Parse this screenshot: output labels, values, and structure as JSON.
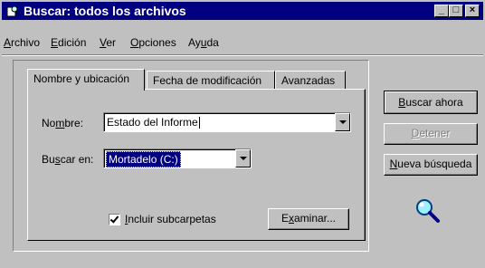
{
  "window": {
    "title": "Buscar: todos los archivos",
    "minimize_glyph": "_",
    "maximize_glyph": "□",
    "close_glyph": "×"
  },
  "menu": {
    "items": [
      {
        "pre": "",
        "key": "A",
        "post": "rchivo"
      },
      {
        "pre": "",
        "key": "E",
        "post": "dición"
      },
      {
        "pre": "",
        "key": "V",
        "post": "er"
      },
      {
        "pre": "",
        "key": "O",
        "post": "pciones"
      },
      {
        "pre": "Ay",
        "key": "u",
        "post": "da"
      }
    ]
  },
  "tabs": [
    {
      "label": "Nombre y ubicación",
      "active": true
    },
    {
      "label": "Fecha de modificación",
      "active": false
    },
    {
      "label": "Avanzadas",
      "active": false
    }
  ],
  "form": {
    "name_label": {
      "pre": "No",
      "key": "m",
      "post": "bre:"
    },
    "name_value": "Estado del Informe",
    "search_in_label": {
      "pre": "Bu",
      "key": "s",
      "post": "car en:"
    },
    "search_in_value": "Mortadelo (C:)",
    "include_subfolders": {
      "pre": "",
      "key": "I",
      "post": "ncluir subcarpetas",
      "checked": true
    },
    "browse_button": {
      "pre": "E",
      "key": "x",
      "post": "aminar..."
    }
  },
  "actions": {
    "search_now": {
      "pre": "",
      "key": "B",
      "post": "uscar ahora"
    },
    "stop": {
      "pre": "",
      "key": "D",
      "post": "etener"
    },
    "new_search": {
      "pre": "",
      "key": "N",
      "post": "ueva búsqueda"
    }
  },
  "icons": {
    "title_icon": "search-icon",
    "magnifier": "magnifier-icon"
  },
  "colors": {
    "titlebar": "#000080",
    "face": "#c0c0c0",
    "selection": "#000080"
  }
}
